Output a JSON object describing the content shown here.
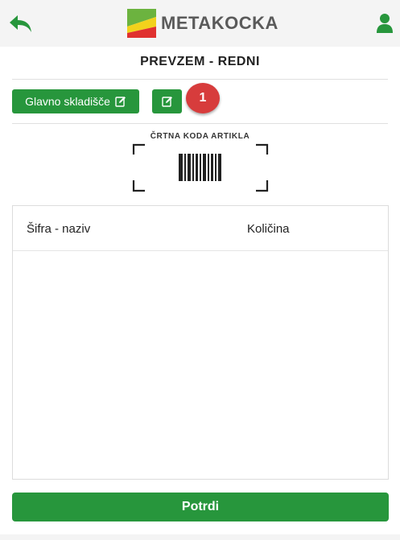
{
  "header": {
    "brand": "METAKOCKA",
    "back_icon": "back-arrow-icon",
    "user_icon": "user-icon",
    "accent_color": "#27963c"
  },
  "page": {
    "title": "PREVZEM - REDNI"
  },
  "toolbar": {
    "warehouse_label": "Glavno skladišče",
    "warehouse_icon": "edit-icon",
    "edit_icon": "edit-icon",
    "badge_count": "1",
    "badge_color": "#d73c3c"
  },
  "scanner": {
    "label": "ČRTNA KODA ARTIKLA",
    "icon": "barcode-icon"
  },
  "table": {
    "columns": [
      "Šifra - naziv",
      "Količina"
    ],
    "rows": []
  },
  "footer": {
    "confirm_label": "Potrdi"
  }
}
